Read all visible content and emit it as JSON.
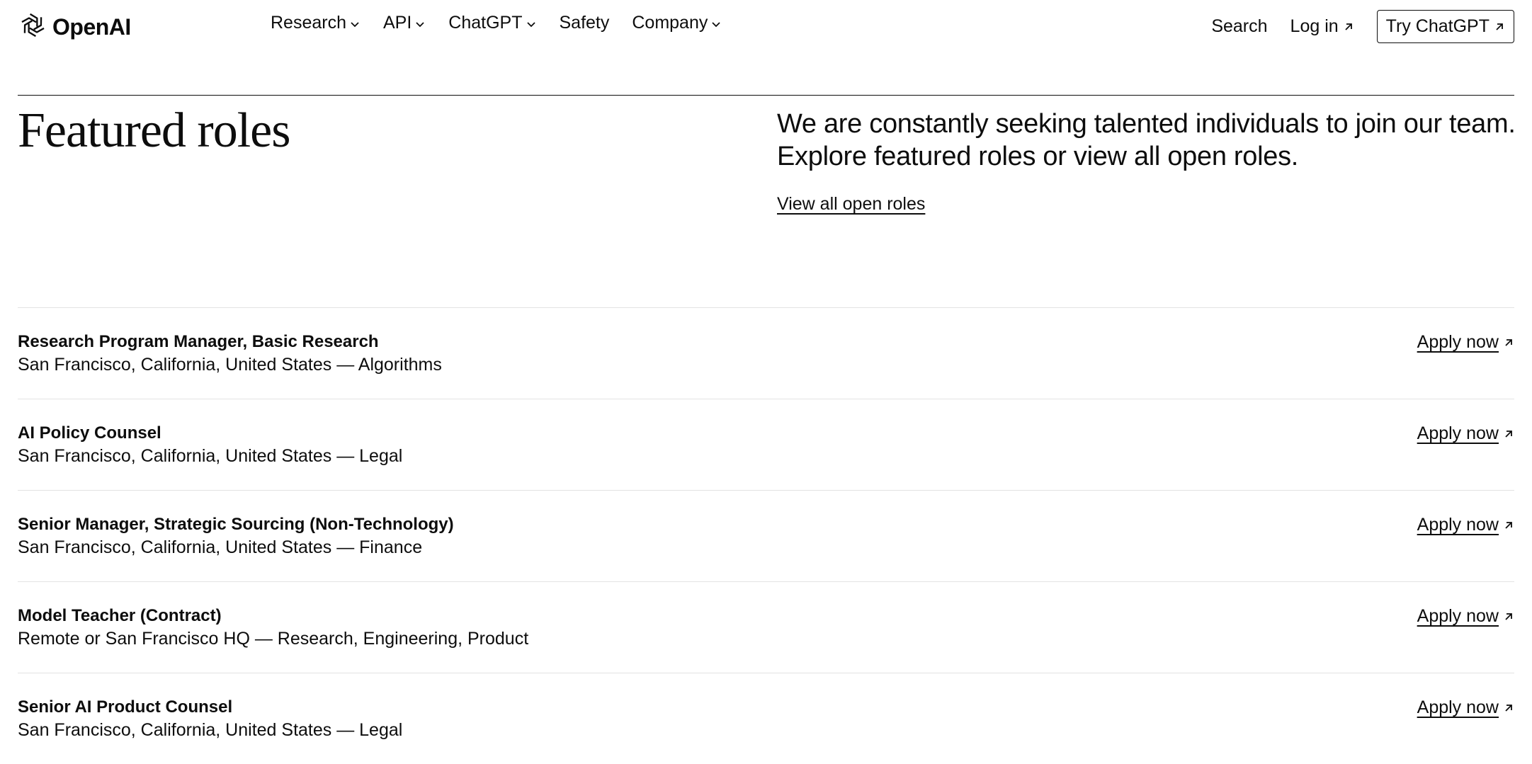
{
  "nav": {
    "brand": "OpenAI",
    "menu": [
      {
        "label": "Research",
        "has_dropdown": true
      },
      {
        "label": "API",
        "has_dropdown": true
      },
      {
        "label": "ChatGPT",
        "has_dropdown": true
      },
      {
        "label": "Safety",
        "has_dropdown": false
      },
      {
        "label": "Company",
        "has_dropdown": true
      }
    ],
    "search_label": "Search",
    "login_label": "Log in",
    "try_label": "Try ChatGPT"
  },
  "section": {
    "title": "Featured roles",
    "intro": "We are constantly seeking talented individuals to join our team. Explore featured roles or view all open roles.",
    "view_all_label": "View all open roles"
  },
  "roles": [
    {
      "title": "Research Program Manager, Basic Research",
      "meta": "San Francisco, California, United States — Algorithms",
      "apply_label": "Apply now"
    },
    {
      "title": "AI Policy Counsel",
      "meta": "San Francisco, California, United States — Legal",
      "apply_label": "Apply now"
    },
    {
      "title": "Senior Manager, Strategic Sourcing (Non-Technology)",
      "meta": "San Francisco, California, United States — Finance",
      "apply_label": "Apply now"
    },
    {
      "title": "Model Teacher (Contract)",
      "meta": "Remote or San Francisco HQ — Research, Engineering, Product",
      "apply_label": "Apply now"
    },
    {
      "title": "Senior AI Product Counsel",
      "meta": "San Francisco, California, United States — Legal",
      "apply_label": "Apply now"
    }
  ],
  "icons": {
    "logo": "openai-logo-icon",
    "dropdown": "chevron-down-icon",
    "external": "arrow-up-right-icon"
  },
  "colors": {
    "text": "#0d0d0d",
    "background": "#ffffff",
    "divider": "#e3e3e3"
  }
}
